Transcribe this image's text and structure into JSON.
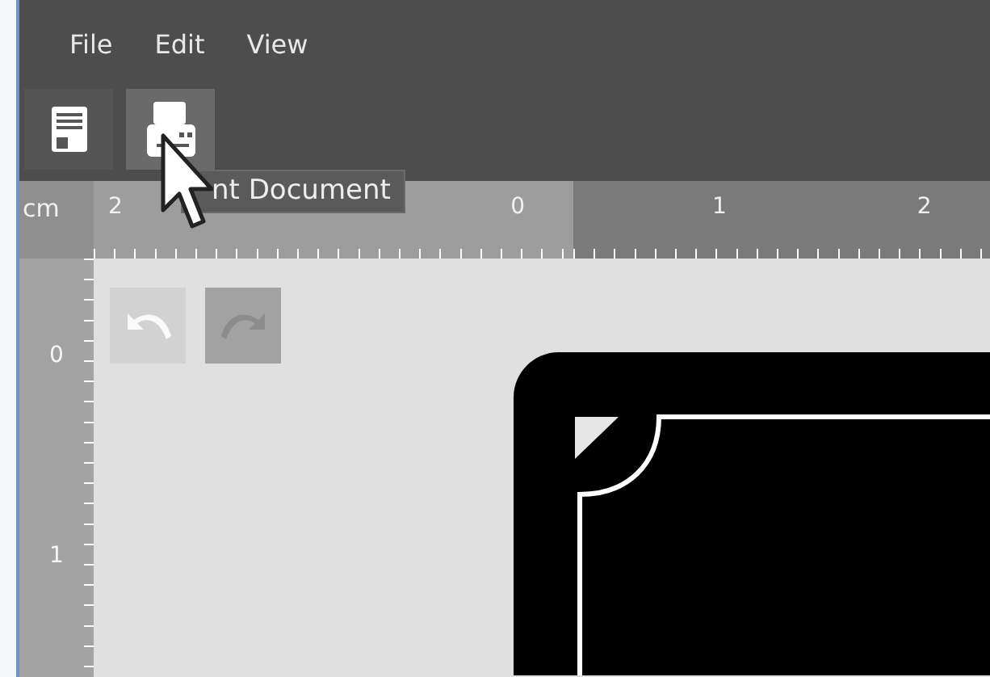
{
  "menu": [
    "File",
    "Edit",
    "View"
  ],
  "toolbar": [
    {
      "kind": "save",
      "hovered": false
    },
    {
      "kind": "print",
      "hovered": true
    }
  ],
  "tooltip": {
    "text": "nt Document"
  },
  "ruler": {
    "unit": "cm",
    "segments": [
      {
        "highlighted": true,
        "labels": [
          "2",
          "0"
        ]
      },
      {
        "highlighted": false,
        "labels": [
          "1",
          "2"
        ]
      }
    ],
    "side_labels": [
      "0",
      "1"
    ]
  },
  "history": [
    {
      "kind": "undo"
    },
    {
      "kind": "redo"
    }
  ]
}
